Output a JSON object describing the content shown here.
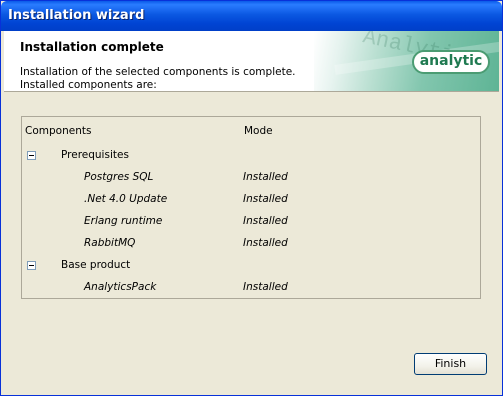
{
  "window": {
    "title": "Installation wizard"
  },
  "banner": {
    "heading": "Installation complete",
    "description": "Installation of the selected components is complete. Installed components are:",
    "brand": "analytic",
    "watermark": "Analytic"
  },
  "table": {
    "columns": [
      "Components",
      "Mode"
    ],
    "groups": [
      {
        "label": "Prerequisites",
        "items": [
          {
            "name": "Postgres SQL",
            "mode": "Installed"
          },
          {
            "name": ".Net 4.0 Update",
            "mode": "Installed"
          },
          {
            "name": "Erlang runtime",
            "mode": "Installed"
          },
          {
            "name": "RabbitMQ",
            "mode": "Installed"
          }
        ]
      },
      {
        "label": "Base product",
        "items": [
          {
            "name": "AnalyticsPack",
            "mode": "Installed"
          }
        ]
      }
    ]
  },
  "buttons": {
    "finish": "Finish"
  }
}
